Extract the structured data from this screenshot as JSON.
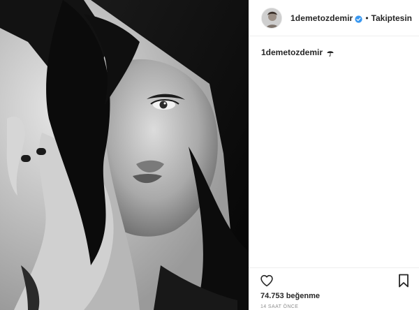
{
  "post": {
    "username": "1demetozdemir",
    "follow_status": "Takiptesin",
    "separator": "•",
    "caption_user": "1demetozdemir",
    "likes": "74.753 beğenme",
    "timestamp": "14 SAAT ÖNCE"
  },
  "icons": {
    "verified": "verified-badge-icon",
    "caption_emoji": "umbrella-icon",
    "like": "heart-icon",
    "save": "bookmark-icon"
  },
  "colors": {
    "text": "#262626",
    "verified": "#3897f0",
    "muted": "#8e8e8e",
    "divider": "#efefef"
  }
}
